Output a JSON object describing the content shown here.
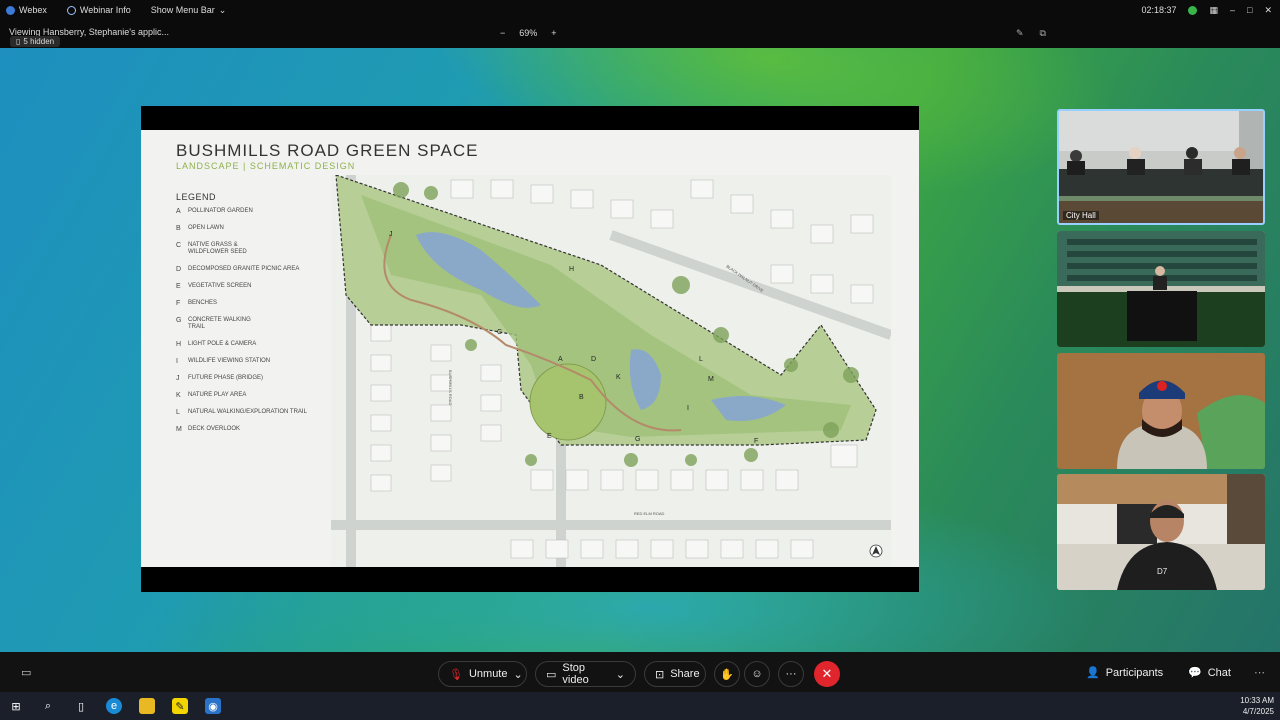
{
  "topbar": {
    "app_name": "Webex",
    "webinar_info": "Webinar Info",
    "show_menu_bar": "Show Menu Bar",
    "clock": "02:18:37"
  },
  "subbar": {
    "viewing": "Viewing Hansberry, Stephanie's applic...",
    "hidden_count": "5 hidden",
    "zoom_minus": "−",
    "zoom_level": "69%",
    "zoom_plus": "+"
  },
  "slide": {
    "title": "BUSHMILLS ROAD GREEN SPACE",
    "subtitle": "LANDSCAPE | SCHEMATIC DESIGN",
    "legend_heading": "LEGEND",
    "legend": [
      {
        "key": "A",
        "text": "Pollinator Garden"
      },
      {
        "key": "B",
        "text": "Open Lawn"
      },
      {
        "key": "C",
        "text": "Native Grass &\nWildflower Seed"
      },
      {
        "key": "D",
        "text": "Decomposed Granite Picnic Area"
      },
      {
        "key": "E",
        "text": "Vegetative Screen"
      },
      {
        "key": "F",
        "text": "Benches"
      },
      {
        "key": "G",
        "text": "Concrete Walking\nTrail"
      },
      {
        "key": "H",
        "text": "Light Pole & Camera"
      },
      {
        "key": "I",
        "text": "Wildlife Viewing Station"
      },
      {
        "key": "J",
        "text": "Future Phase (Bridge)"
      },
      {
        "key": "K",
        "text": "Nature Play Area"
      },
      {
        "key": "L",
        "text": "Natural Walking/Exploration Trail"
      },
      {
        "key": "M",
        "text": "Deck Overlook"
      }
    ],
    "map_labels": {
      "bushmills": "BUSHMILLS ROAD",
      "blackwalnut": "BLACK WALNUT DRIVE",
      "redelm": "RED ELM ROAD"
    }
  },
  "tiles": [
    {
      "label": "City Hall"
    },
    {
      "label": ""
    },
    {
      "label": ""
    },
    {
      "label": ""
    }
  ],
  "controls": {
    "unmute": "Unmute",
    "stop_video": "Stop video",
    "share": "Share",
    "more": "···",
    "participants": "Participants",
    "chat": "Chat"
  },
  "taskbar": {
    "time": "10:33 AM",
    "date": "4/7/2025"
  },
  "colors": {
    "end_call": "#e0262c",
    "accent_green": "#8fb04a",
    "tile_highlight": "#9ad0ff"
  }
}
